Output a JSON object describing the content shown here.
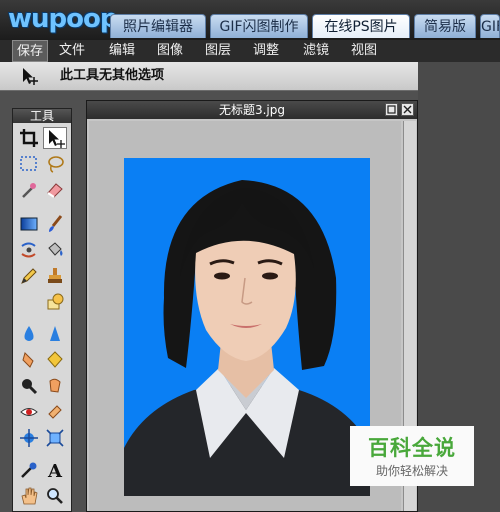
{
  "logo": {
    "text": "wupoop"
  },
  "tabs": [
    {
      "label": "照片编辑器"
    },
    {
      "label": "GIF闪图制作"
    },
    {
      "label": "在线PS图片"
    },
    {
      "label": "简易版"
    },
    {
      "label": "GIF"
    }
  ],
  "active_tab": "在线PS图片",
  "menu": [
    {
      "label": "保存"
    },
    {
      "label": "文件"
    },
    {
      "label": "编辑"
    },
    {
      "label": "图像"
    },
    {
      "label": "图层"
    },
    {
      "label": "调整"
    },
    {
      "label": "滤镜"
    },
    {
      "label": "视图"
    }
  ],
  "options_bar": {
    "text": "此工具无其他选项",
    "tool_icon": "move-tool-icon"
  },
  "tools_panel": {
    "title": "工具",
    "tools": [
      "crop-icon",
      "move-arrow-icon",
      "marquee-select-icon",
      "lasso-icon",
      "magic-wand-icon",
      "eraser-icon",
      "gradient-rectangle-icon",
      "brush-icon",
      "color-replace-icon",
      "paint-bucket-icon",
      "pencil-icon",
      "clone-stamp-icon",
      "shape-icon",
      "blur-drop-icon",
      "sharpen-icon",
      "smudge-icon",
      "sponge-icon",
      "zoom-icon",
      "burn-icon",
      "red-eye-icon",
      "dodge-icon",
      "transform-icon",
      "resize-icon",
      "color-picker-icon",
      "text-icon",
      "hand-icon",
      "magnifier-icon"
    ]
  },
  "document": {
    "title": "无标题3.jpg"
  },
  "watermark": {
    "title": "百科全说",
    "subtitle": "助你轻松解决"
  },
  "colors": {
    "photo_background": "#0a7ff4",
    "toolbar_bg": "#2b2b2b",
    "tab_active": "#ffffff"
  }
}
